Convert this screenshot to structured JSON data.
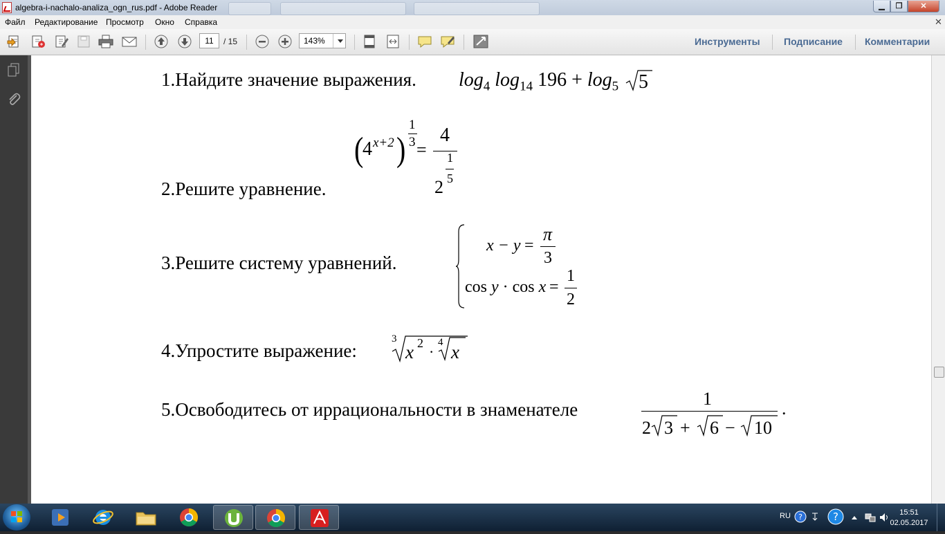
{
  "window": {
    "title": "algebra-i-nachalo-analiza_ogn_rus.pdf - Adobe Reader"
  },
  "menu": [
    "Файл",
    "Редактирование",
    "Просмотр",
    "Окно",
    "Справка"
  ],
  "toolbar": {
    "page_current": "11",
    "page_total": "/ 15",
    "zoom": "143%",
    "links": {
      "tools": "Инструменты",
      "sign": "Подписание",
      "comments": "Комментарии"
    }
  },
  "document": {
    "q1_text": "1.Найдите значение выражения.",
    "q2_text": "2.Решите уравнение.",
    "q3_text": "3.Решите систему уравнений.",
    "q4_text": "4.Упростите выражение:",
    "q5_text": "5.Освободитесь от иррациональности в знаменателе",
    "q5_end": ".",
    "math": {
      "log": "log",
      "b4": "4",
      "b14": "14",
      "n196": "196",
      "plus": "+",
      "b5": "5",
      "r5": "5",
      "eq2_base": "4",
      "eq2_exp": "x+2",
      "one": "1",
      "three": "3",
      "eq": "=",
      "four": "4",
      "two": "2",
      "five": "5",
      "sys1_lhs": "x − y",
      "pi": "π",
      "sys2_cos1": "cos",
      "y": "y",
      "dot": "·",
      "cos2": "cos",
      "x": "x",
      "q4_x": "x",
      "q4_2": "2",
      "q4_dot": "·",
      "q4_4": "4",
      "q4_x2": "x",
      "q4_3": "3",
      "q5_num": "1",
      "q5_2": "2",
      "q5_3": "3",
      "q5_plus": "+",
      "q5_6": "6",
      "q5_minus": "−",
      "q5_10": "10"
    }
  },
  "tray": {
    "lang": "RU",
    "time": "15:51",
    "date": "02.05.2017"
  }
}
